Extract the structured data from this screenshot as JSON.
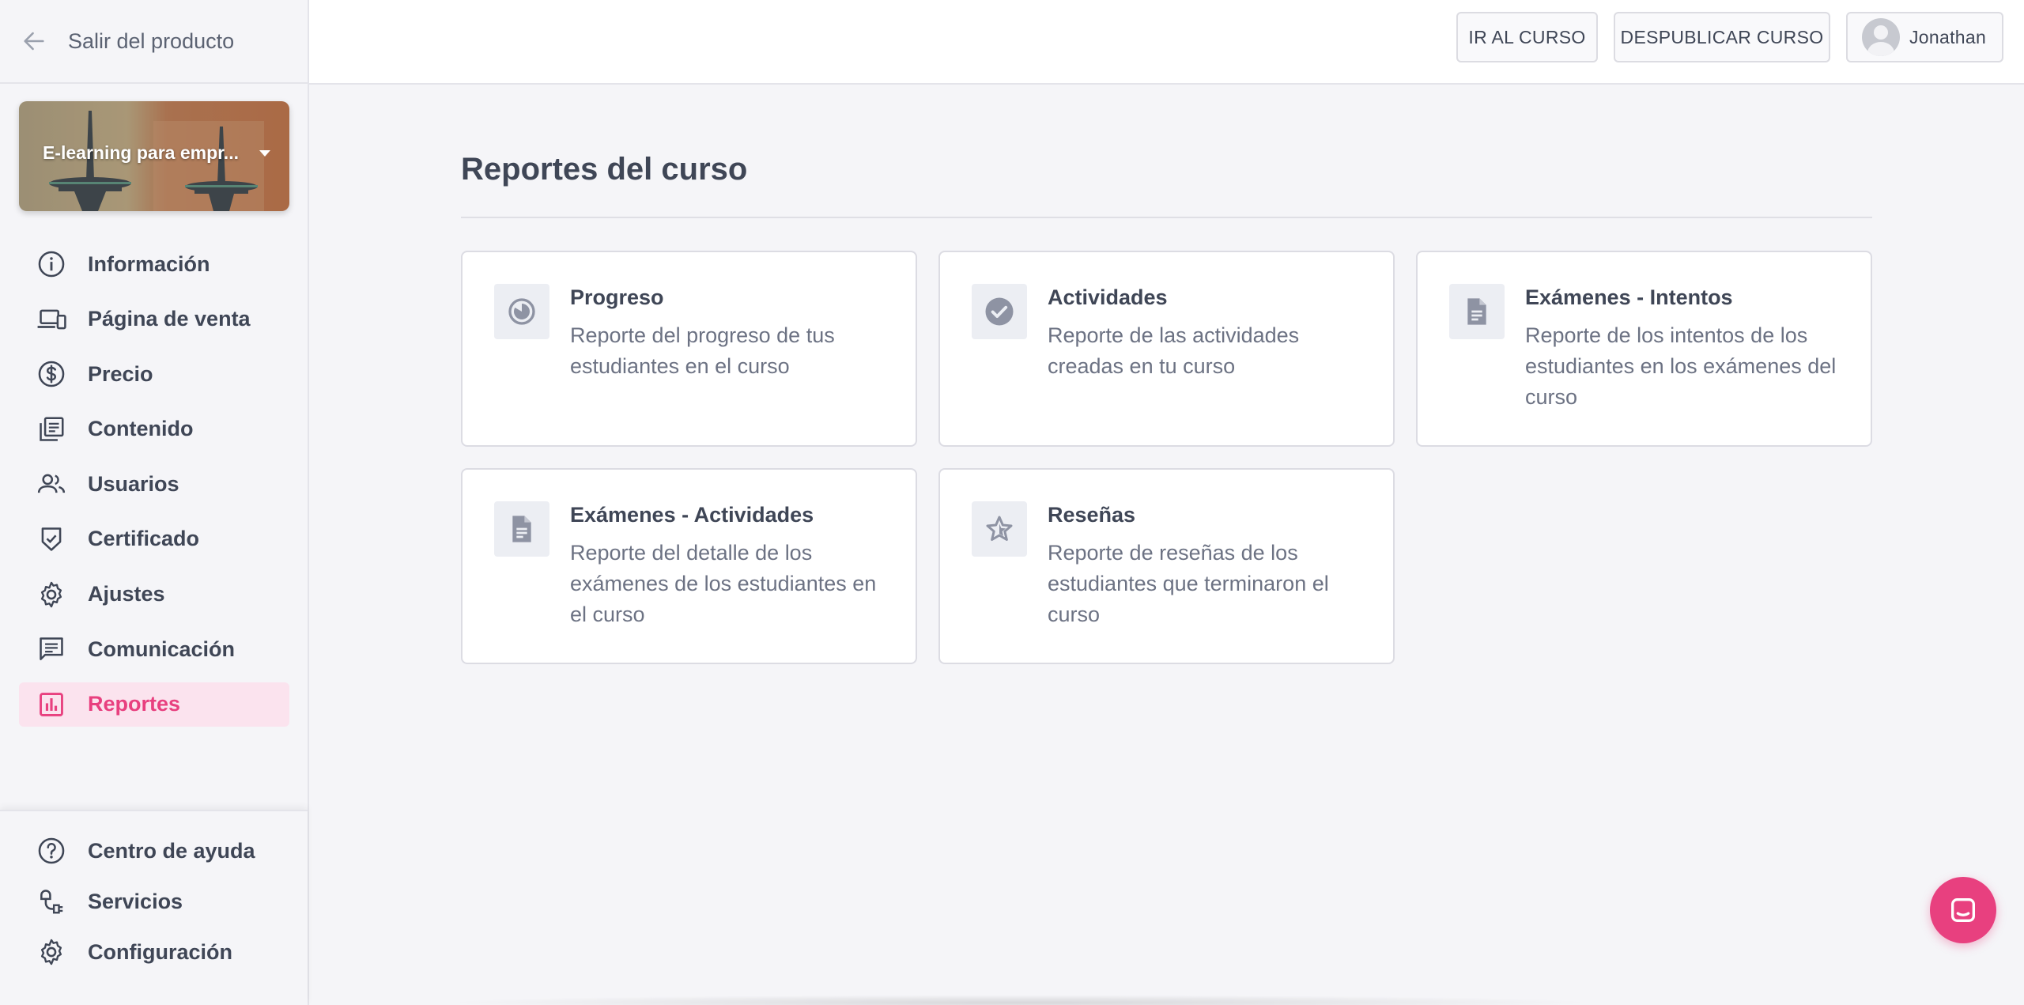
{
  "sidebar": {
    "back_label": "Salir del producto",
    "course_title": "E-learning para empr...",
    "items": [
      {
        "label": "Información",
        "icon": "info-icon"
      },
      {
        "label": "Página de venta",
        "icon": "devices-icon"
      },
      {
        "label": "Precio",
        "icon": "dollar-icon"
      },
      {
        "label": "Contenido",
        "icon": "library-icon"
      },
      {
        "label": "Usuarios",
        "icon": "users-icon"
      },
      {
        "label": "Certificado",
        "icon": "shield-check-icon"
      },
      {
        "label": "Ajustes",
        "icon": "gear-icon"
      },
      {
        "label": "Comunicación",
        "icon": "chat-icon"
      },
      {
        "label": "Reportes",
        "icon": "bar-chart-icon",
        "active": true
      }
    ],
    "footer_items": [
      {
        "label": "Centro de ayuda",
        "icon": "help-icon"
      },
      {
        "label": "Servicios",
        "icon": "plug-icon"
      },
      {
        "label": "Configuración",
        "icon": "gear-icon"
      }
    ]
  },
  "header": {
    "go_course_label": "IR AL CURSO",
    "unpublish_label": "DESPUBLICAR CURSO",
    "user_name": "Jonathan"
  },
  "main": {
    "title": "Reportes del curso",
    "cards": [
      {
        "title": "Progreso",
        "description": "Reporte del progreso de tus estudiantes en el curso",
        "icon": "progress-pie-icon"
      },
      {
        "title": "Actividades",
        "description": "Reporte de las actividades creadas en tu curso",
        "icon": "check-circle-icon"
      },
      {
        "title": "Exámenes - Intentos",
        "description": "Reporte de los intentos de los estudiantes en los exámenes del curso",
        "icon": "document-icon"
      },
      {
        "title": "Exámenes - Actividades",
        "description": "Reporte del detalle de los exámenes de los estudiantes en el curso",
        "icon": "document-icon"
      },
      {
        "title": "Reseñas",
        "description": "Reporte de reseñas de los estudiantes que terminaron el curso",
        "icon": "star-icon"
      }
    ]
  },
  "colors": {
    "accent": "#e8407f",
    "active_bg": "#fbe3ee",
    "text": "#3f4656",
    "muted": "#6c7283",
    "icon_gray": "#8e93a3"
  }
}
